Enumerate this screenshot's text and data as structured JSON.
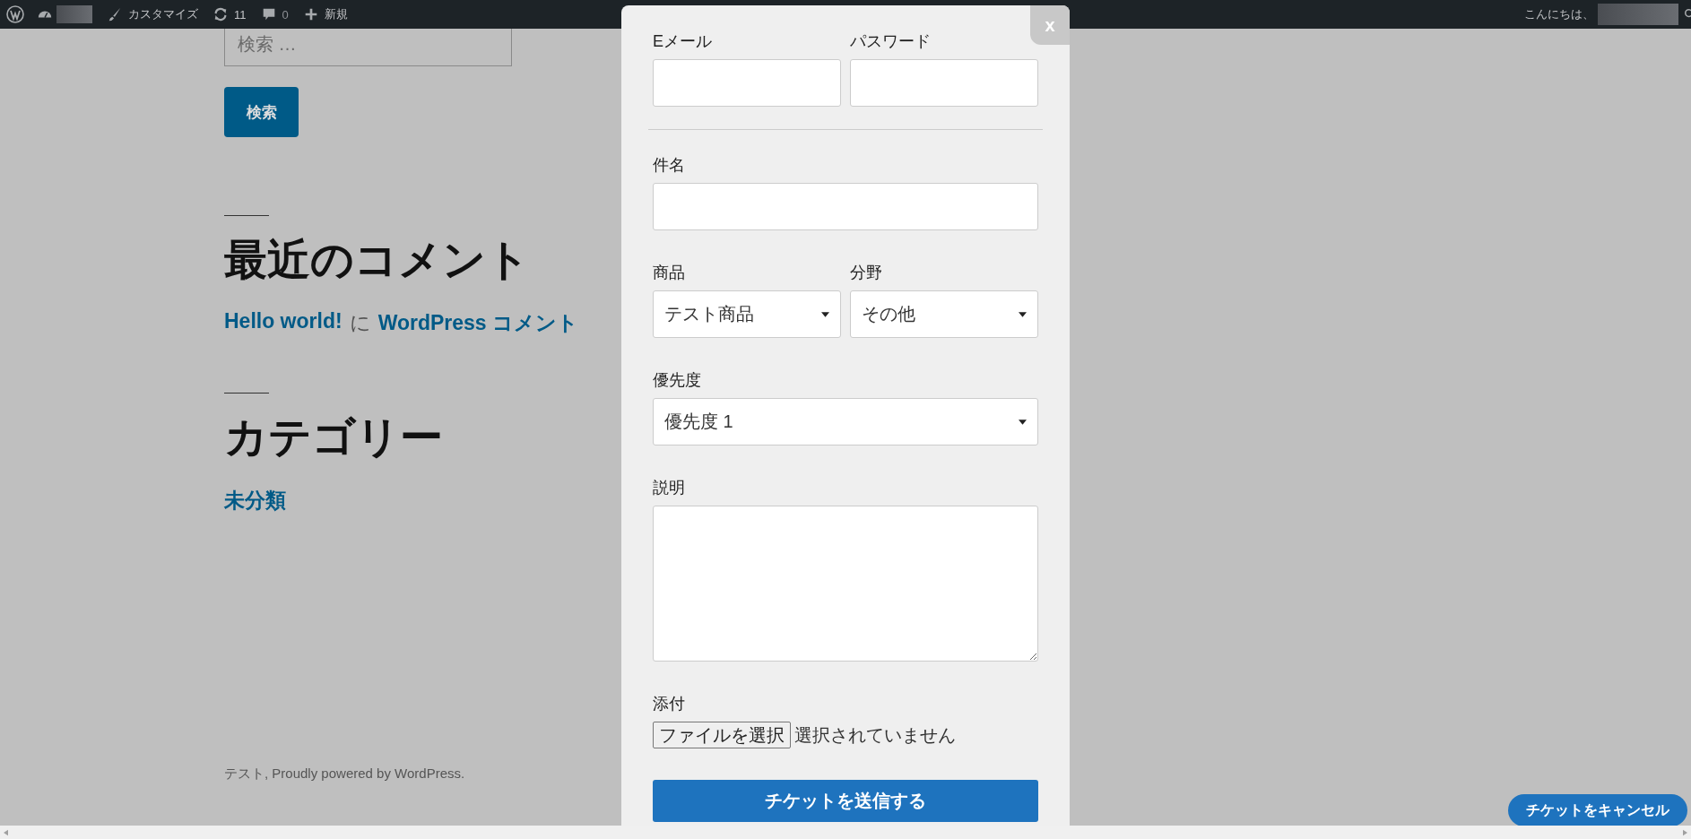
{
  "admin_bar": {
    "items": [
      {
        "kind": "customize",
        "label": "カスタマイズ"
      },
      {
        "kind": "updates",
        "label": "11"
      },
      {
        "kind": "comments",
        "label": "0"
      },
      {
        "kind": "new",
        "label": "新規"
      }
    ],
    "greeting": "こんにちは、"
  },
  "sidebar": {
    "search": {
      "placeholder": "検索 …",
      "button": "検索"
    },
    "widgets": [
      {
        "title": "最近のコメント",
        "kind": "comment",
        "link_1": "Hello world!",
        "joiner": "に",
        "link_2": "WordPress コメント"
      },
      {
        "title": "カテゴリー",
        "kind": "links",
        "links": [
          "未分類"
        ]
      }
    ]
  },
  "footer": "テスト, Proudly powered by WordPress.",
  "modal": {
    "close": "x",
    "account_fields": [
      {
        "kind": "text",
        "label": "Eメール"
      },
      {
        "kind": "text",
        "label": "パスワード"
      }
    ],
    "rows": [
      {
        "fields": [
          {
            "kind": "text",
            "label": "件名"
          }
        ]
      },
      {
        "fields": [
          {
            "kind": "select",
            "label": "商品",
            "value": "テスト商品"
          },
          {
            "kind": "select",
            "label": "分野",
            "value": "その他"
          }
        ]
      },
      {
        "fields": [
          {
            "kind": "select",
            "label": "優先度",
            "value": "優先度 1"
          }
        ]
      },
      {
        "fields": [
          {
            "kind": "textarea",
            "label": "説明"
          }
        ]
      },
      {
        "fields": [
          {
            "kind": "file",
            "label": "添付",
            "button": "ファイルを選択",
            "status": "選択されていません"
          }
        ]
      }
    ],
    "submit": "チケットを送信する"
  },
  "cancel_button": "チケットをキャンセル"
}
